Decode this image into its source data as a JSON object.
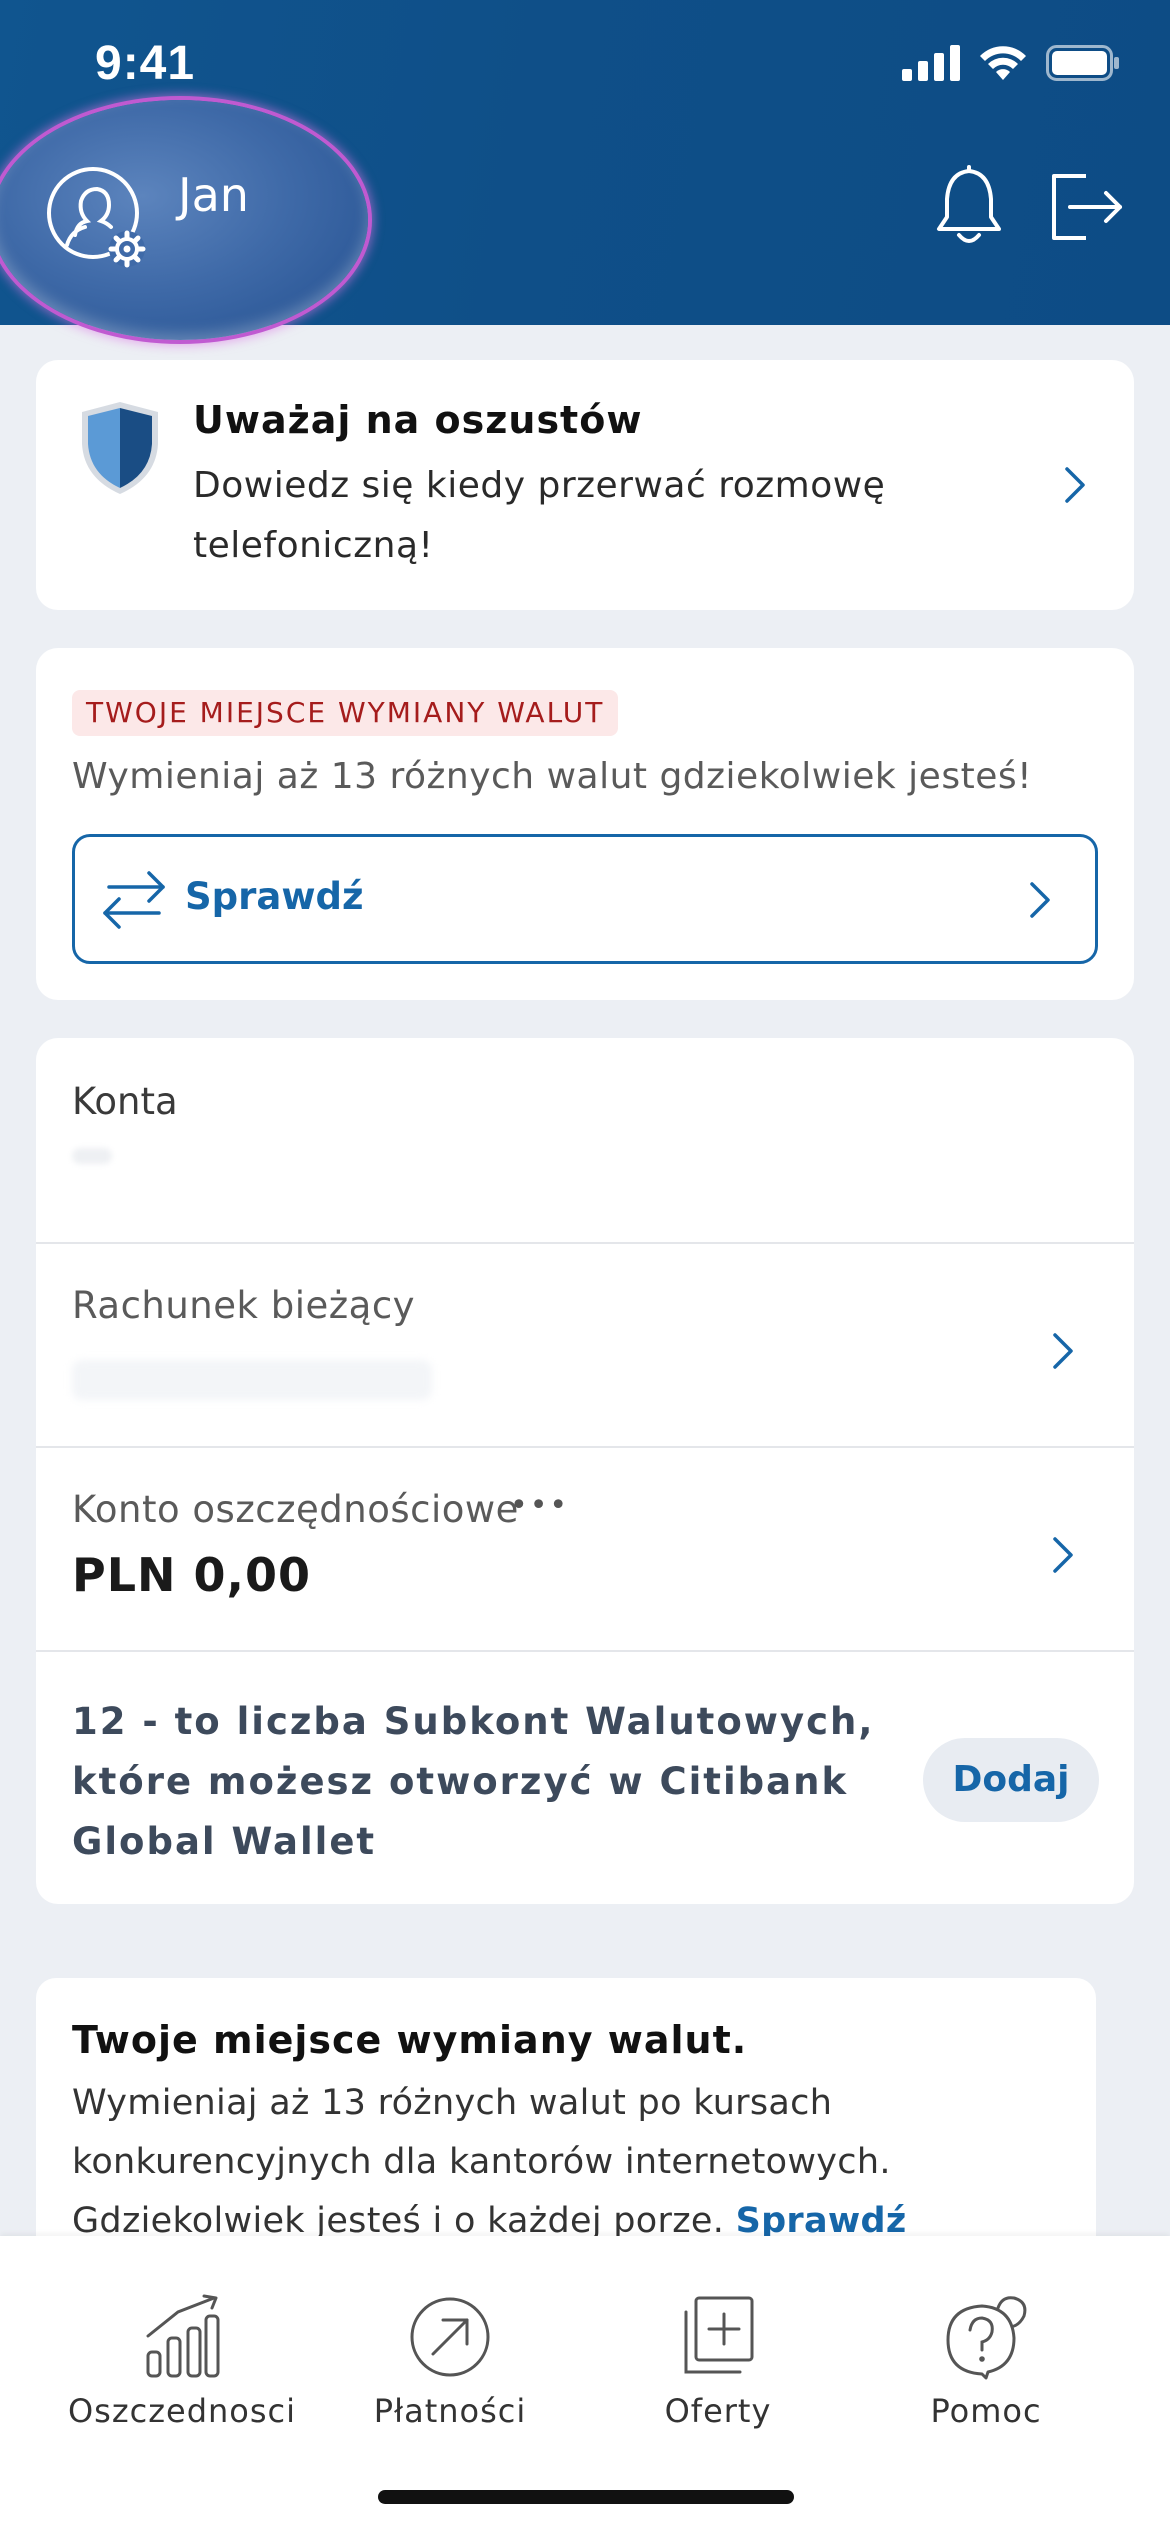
{
  "status_bar": {
    "time": "9:41"
  },
  "header": {
    "user_name": "Jan",
    "icons": [
      "profile-settings-icon",
      "bell-icon",
      "logout-icon"
    ]
  },
  "fraud_alert": {
    "title": "Uważaj na oszustów",
    "description": "Dowiedz się kiedy przerwać rozmowę telefoniczną!"
  },
  "fx_card": {
    "badge": "TWOJE MIEJSCE WYMIANY WALUT",
    "description": "Wymieniaj aż 13 różnych walut gdziekolwiek jesteś!",
    "button_label": "Sprawdź"
  },
  "accounts": {
    "title": "Konta",
    "items": [
      {
        "name": "Rachunek bieżący",
        "masked_number": "",
        "balance": ""
      },
      {
        "name": "Konto oszczędnościowe",
        "masked_number": "•••",
        "balance": "PLN 0,00"
      }
    ],
    "subaccounts_text": "12 - to liczba Subkont Walutowych, które możesz otworzyć w Citibank Global Wallet",
    "add_label": "Dodaj"
  },
  "promo": {
    "title": "Twoje miejsce wymiany walut.",
    "text": "Wymieniaj aż 13 różnych walut po kursach konkurencyjnych dla kantorów internetowych. Gdziekolwiek jesteś i o każdej porze.",
    "link": "Sprawdź"
  },
  "tabbar": {
    "items": [
      {
        "label": "Oszczednosci",
        "icon": "chart-icon"
      },
      {
        "label": "Płatności",
        "icon": "payment-arrow-icon"
      },
      {
        "label": "Oferty",
        "icon": "offers-icon"
      },
      {
        "label": "Pomoc",
        "icon": "help-icon"
      }
    ]
  },
  "colors": {
    "header_blue": "#0f4f88",
    "accent_blue": "#1666a8",
    "badge_red": "#a51c1c",
    "badge_bg": "#fce8e8",
    "page_bg": "#eceff4"
  }
}
